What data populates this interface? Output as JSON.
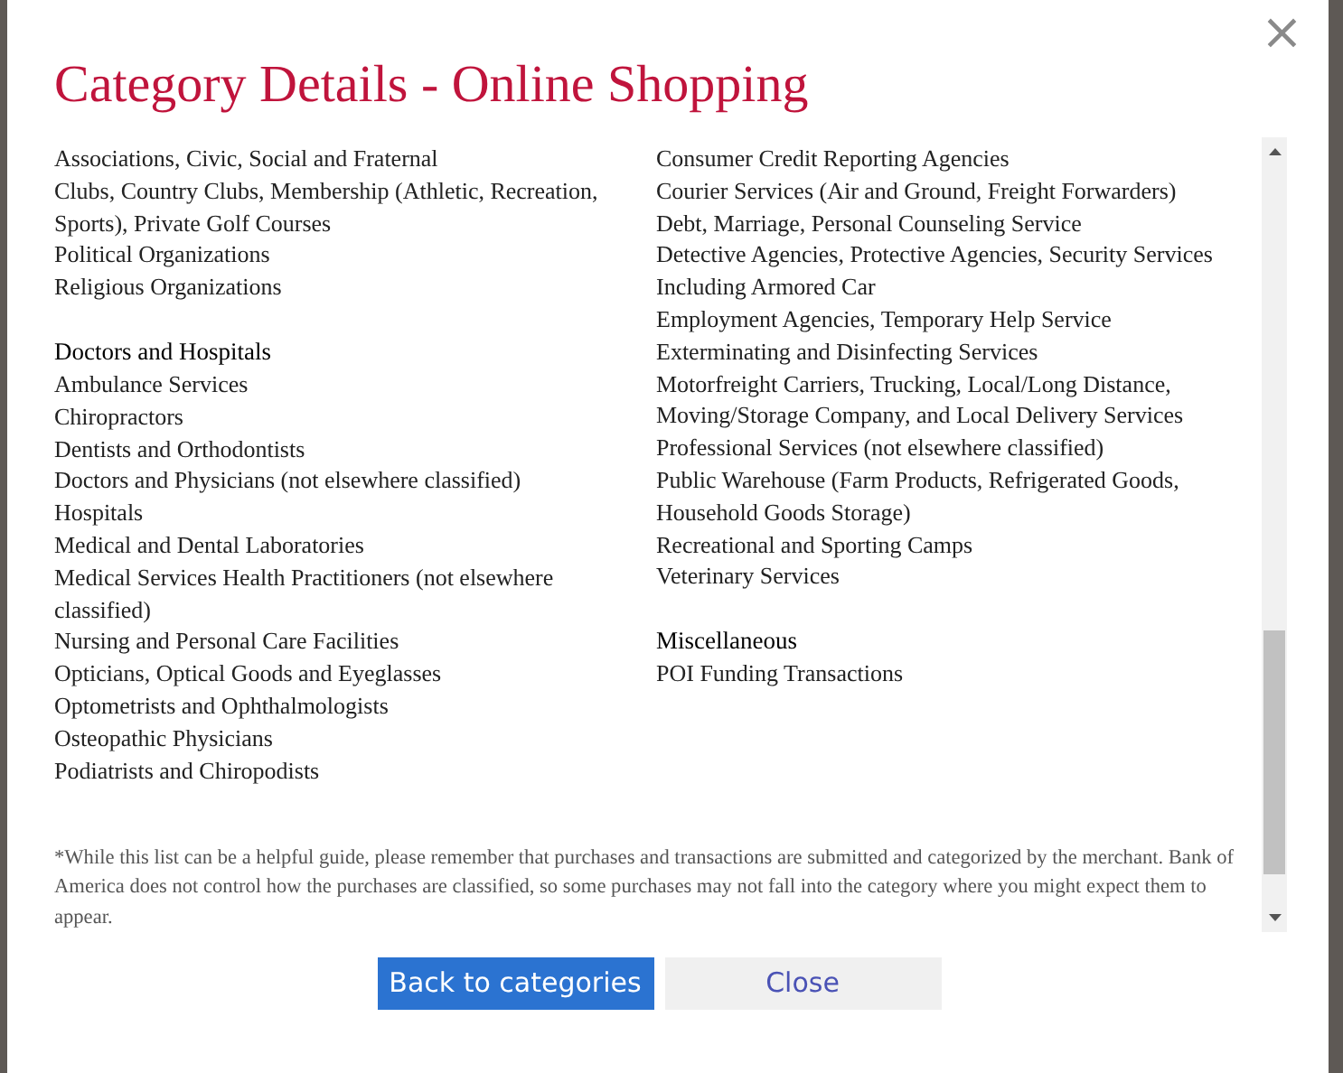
{
  "dialog": {
    "title": "Category Details - Online Shopping",
    "close_icon_label": "×"
  },
  "columns": [
    {
      "groups": [
        {
          "items": [
            "Associations, Civic, Social and Fraternal",
            "Clubs, Country Clubs, Membership (Athletic, Recreation, Sports), Private Golf Courses",
            "Political Organizations",
            "Religious Organizations"
          ]
        },
        {
          "heading": "Doctors and Hospitals",
          "items": [
            "Ambulance Services",
            "Chiropractors",
            "Dentists and Orthodontists",
            "Doctors and Physicians (not elsewhere classified)",
            "Hospitals",
            "Medical and Dental Laboratories",
            "Medical Services Health Practitioners (not elsewhere classified)",
            "Nursing and Personal Care Facilities",
            "Opticians, Optical Goods and Eyeglasses",
            "Optometrists and Ophthalmologists",
            "Osteopathic Physicians",
            "Podiatrists and Chiropodists"
          ]
        }
      ]
    },
    {
      "groups": [
        {
          "items": [
            "Consumer Credit Reporting Agencies",
            "Courier Services (Air and Ground, Freight Forwarders)",
            "Debt, Marriage, Personal Counseling Service",
            "Detective Agencies, Protective Agencies, Security Services",
            "Including Armored Car",
            "Employment Agencies, Temporary Help Service",
            "Exterminating and Disinfecting Services",
            "Motorfreight Carriers, Trucking, Local/Long Distance, Moving/Storage Company, and Local Delivery Services",
            "Professional Services (not elsewhere classified)",
            "Public Warehouse (Farm Products, Refrigerated Goods, Household Goods Storage)",
            "Recreational and Sporting Camps",
            "Veterinary Services"
          ]
        },
        {
          "heading": "Miscellaneous",
          "items": [
            "POI Funding Transactions"
          ]
        }
      ]
    }
  ],
  "footnote": "*While this list can be a helpful guide, please remember that purchases and transactions are submitted and categorized by the merchant. Bank of America does not control how the purchases are classified, so some purchases may not fall into the category where you might expect them to appear.",
  "buttons": [
    {
      "label": "Back to categories",
      "kind": "primary"
    },
    {
      "label": "Close",
      "kind": "secondary"
    }
  ]
}
